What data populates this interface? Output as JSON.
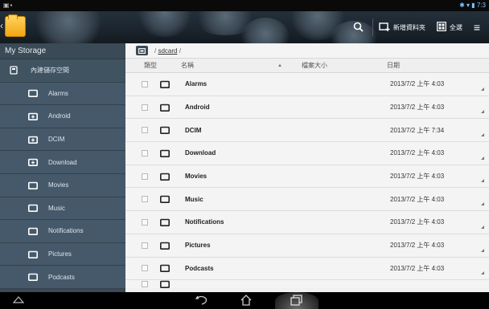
{
  "statusbar": {
    "left_icons": "▣▪",
    "time": "7:3"
  },
  "actionbar": {
    "search_label": "",
    "new_folder_label": "新增資料夾",
    "select_all_label": "全選",
    "menu_label": ""
  },
  "sidebar": {
    "header": "My Storage",
    "root_label": "內建儲存空間",
    "items": [
      {
        "label": "Alarms",
        "icon": "folder-icon"
      },
      {
        "label": "Android",
        "icon": "folder-plus-icon"
      },
      {
        "label": "DCIM",
        "icon": "folder-plus-icon"
      },
      {
        "label": "Download",
        "icon": "folder-plus-icon"
      },
      {
        "label": "Movies",
        "icon": "folder-icon"
      },
      {
        "label": "Music",
        "icon": "folder-icon"
      },
      {
        "label": "Notifications",
        "icon": "folder-icon"
      },
      {
        "label": "Pictures",
        "icon": "folder-icon"
      },
      {
        "label": "Podcasts",
        "icon": "folder-icon"
      }
    ]
  },
  "path": {
    "prefix": "/ ",
    "link": "sdcard",
    "suffix": " /"
  },
  "columns": {
    "type": "類型",
    "name": "名稱",
    "size": "檔案大小",
    "date": "日期"
  },
  "files": [
    {
      "name": "Alarms",
      "date": "2013/7/2 上午 4:03"
    },
    {
      "name": "Android",
      "date": "2013/7/2 上午 4:03"
    },
    {
      "name": "DCIM",
      "date": "2013/7/2 上午 7:34"
    },
    {
      "name": "Download",
      "date": "2013/7/2 上午 4:03"
    },
    {
      "name": "Movies",
      "date": "2013/7/2 上午 4:03"
    },
    {
      "name": "Music",
      "date": "2013/7/2 上午 4:03"
    },
    {
      "name": "Notifications",
      "date": "2013/7/2 上午 4:03"
    },
    {
      "name": "Pictures",
      "date": "2013/7/2 上午 4:03"
    },
    {
      "name": "Podcasts",
      "date": "2013/7/2 上午 4:03"
    }
  ],
  "colors": {
    "sidebar_bg": "#3a4a56",
    "sidebar_child_bg": "#45596a",
    "list_bg": "#f4f4f4",
    "folder_icon_bg": "#f2a515"
  }
}
